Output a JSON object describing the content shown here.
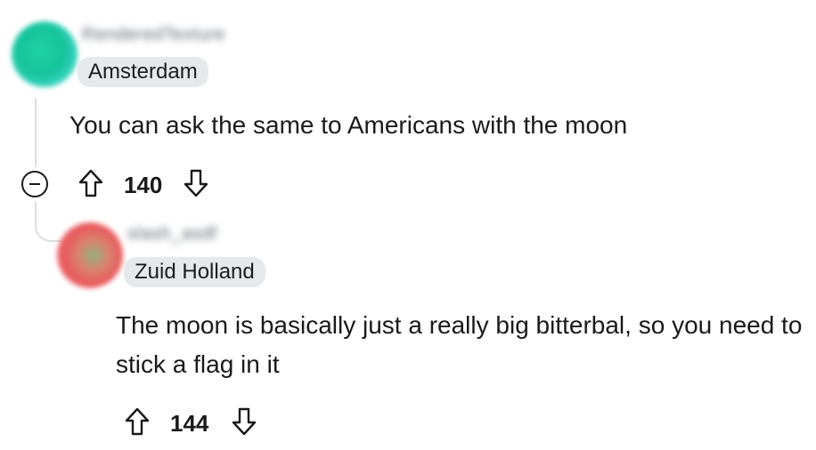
{
  "comments": [
    {
      "username": "RenderedTexture",
      "flair": "Amsterdam",
      "body": "You can ask the same to Americans with the moon",
      "score": "140"
    },
    {
      "username": "slash_asdf",
      "flair": "Zuid Holland",
      "body": "The moon is basically just a really big bitterbal, so you need to stick a flag in it",
      "score": "144"
    }
  ],
  "icons": {
    "collapse": "collapse-icon",
    "upvote": "upvote-arrow-icon",
    "downvote": "downvote-arrow-icon"
  },
  "colors": {
    "avatar_1": "#14c39a",
    "avatar_2": "#e8595c",
    "flair_bg": "#e5e9ec",
    "thread_line": "#dcdfe2"
  }
}
